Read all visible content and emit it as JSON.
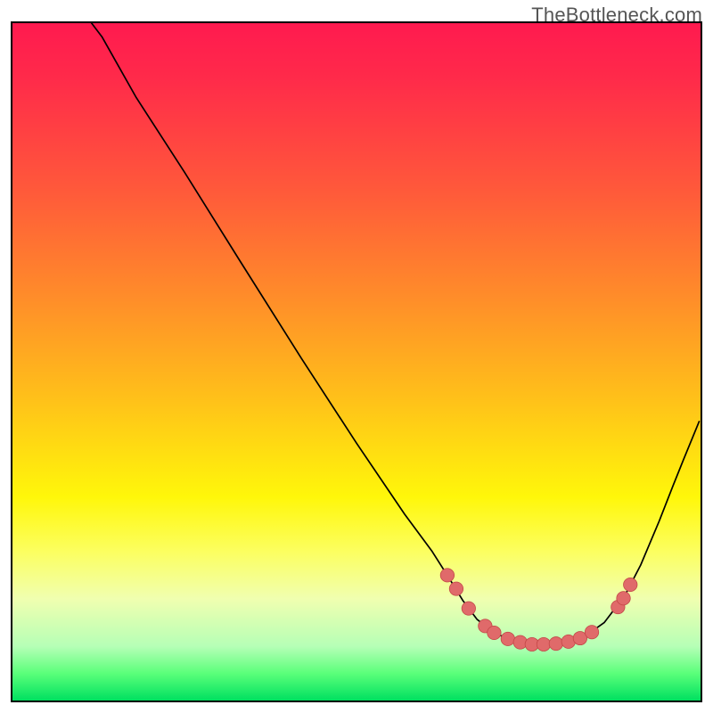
{
  "watermark": "TheBottleneck.com",
  "colors": {
    "curve": "#000000",
    "dot_fill": "#e06a6a",
    "dot_stroke": "#c24646",
    "border": "#000000"
  },
  "chart_data": {
    "type": "line",
    "title": "",
    "xlabel": "",
    "ylabel": "",
    "xlim": [
      0,
      100
    ],
    "ylim": [
      0,
      100
    ],
    "grid": false,
    "legend": false,
    "series": [
      {
        "name": "curve",
        "comment": "Approximate percentage coordinates (x%, y%) of the black curve within the plot box. y measured from TOP (0=top, 100=bottom).",
        "points": [
          [
            11.5,
            0.0
          ],
          [
            13.0,
            2.0
          ],
          [
            18.0,
            11.0
          ],
          [
            25.0,
            22.0
          ],
          [
            33.0,
            35.0
          ],
          [
            42.0,
            49.5
          ],
          [
            50.0,
            62.0
          ],
          [
            57.0,
            72.5
          ],
          [
            61.0,
            78.0
          ],
          [
            63.5,
            82.0
          ],
          [
            65.5,
            85.3
          ],
          [
            67.5,
            88.0
          ],
          [
            70.0,
            90.0
          ],
          [
            73.0,
            91.3
          ],
          [
            76.0,
            91.7
          ],
          [
            80.0,
            91.5
          ],
          [
            83.5,
            90.3
          ],
          [
            86.0,
            88.5
          ],
          [
            89.0,
            84.5
          ],
          [
            91.3,
            80.0
          ],
          [
            94.0,
            73.5
          ],
          [
            96.0,
            68.3
          ],
          [
            97.5,
            64.5
          ],
          [
            99.8,
            58.8
          ]
        ]
      }
    ],
    "markers": {
      "name": "dots",
      "comment": "Pink marker points (x%, y%) near the valley of the curve.",
      "points": [
        [
          63.2,
          81.5
        ],
        [
          64.5,
          83.5
        ],
        [
          66.3,
          86.4
        ],
        [
          68.7,
          89.0
        ],
        [
          70.0,
          90.0
        ],
        [
          72.0,
          90.9
        ],
        [
          73.8,
          91.4
        ],
        [
          75.5,
          91.7
        ],
        [
          77.2,
          91.7
        ],
        [
          79.0,
          91.6
        ],
        [
          80.8,
          91.3
        ],
        [
          82.5,
          90.8
        ],
        [
          84.2,
          89.9
        ],
        [
          88.0,
          86.2
        ],
        [
          88.8,
          84.9
        ],
        [
          89.8,
          82.9
        ]
      ],
      "radius_pct": 1.0
    }
  }
}
